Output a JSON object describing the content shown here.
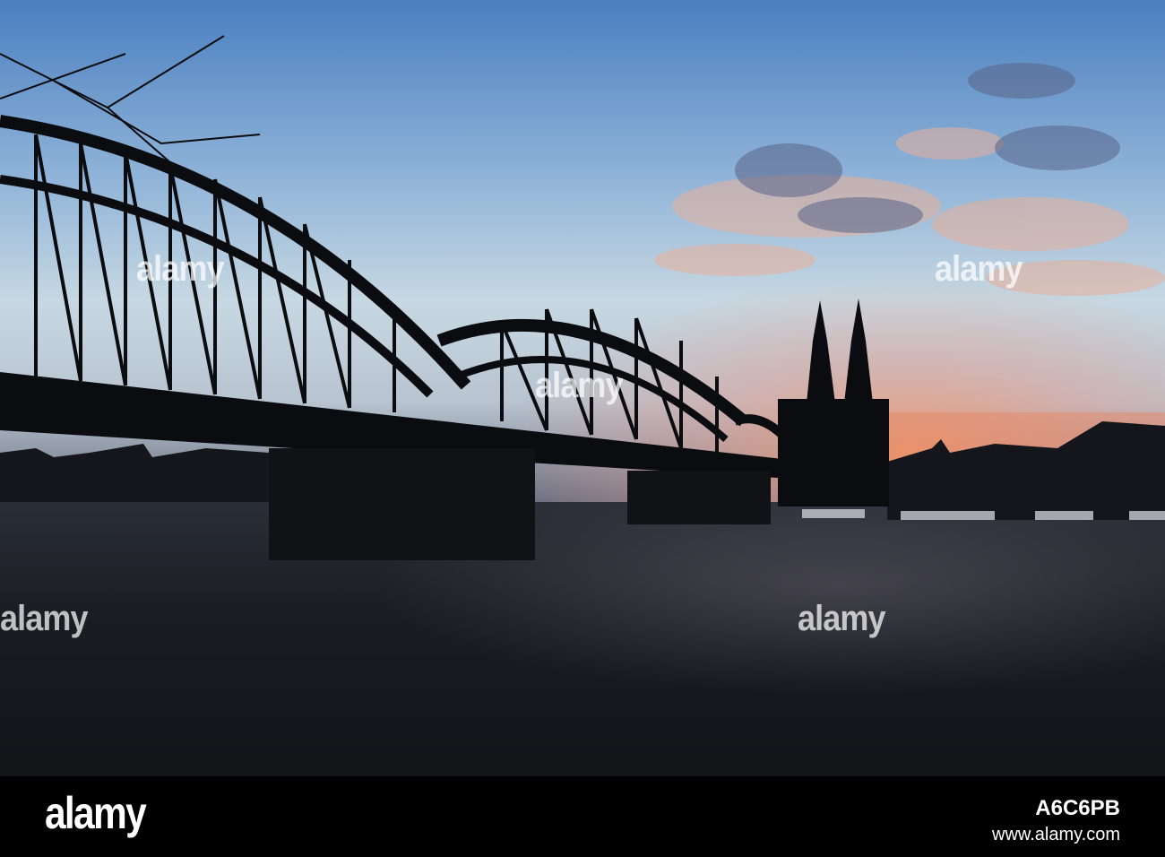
{
  "watermark": {
    "text": "alamy"
  },
  "footer": {
    "logo": "alamy",
    "image_id": "A6C6PB",
    "site": "www.alamy.com"
  },
  "colors": {
    "sky_top": "#4a7fc0",
    "sky_mid": "#b9cfdf",
    "glow": "#f0a07a",
    "water": "#16191e",
    "silhouette": "#0b0c10"
  }
}
